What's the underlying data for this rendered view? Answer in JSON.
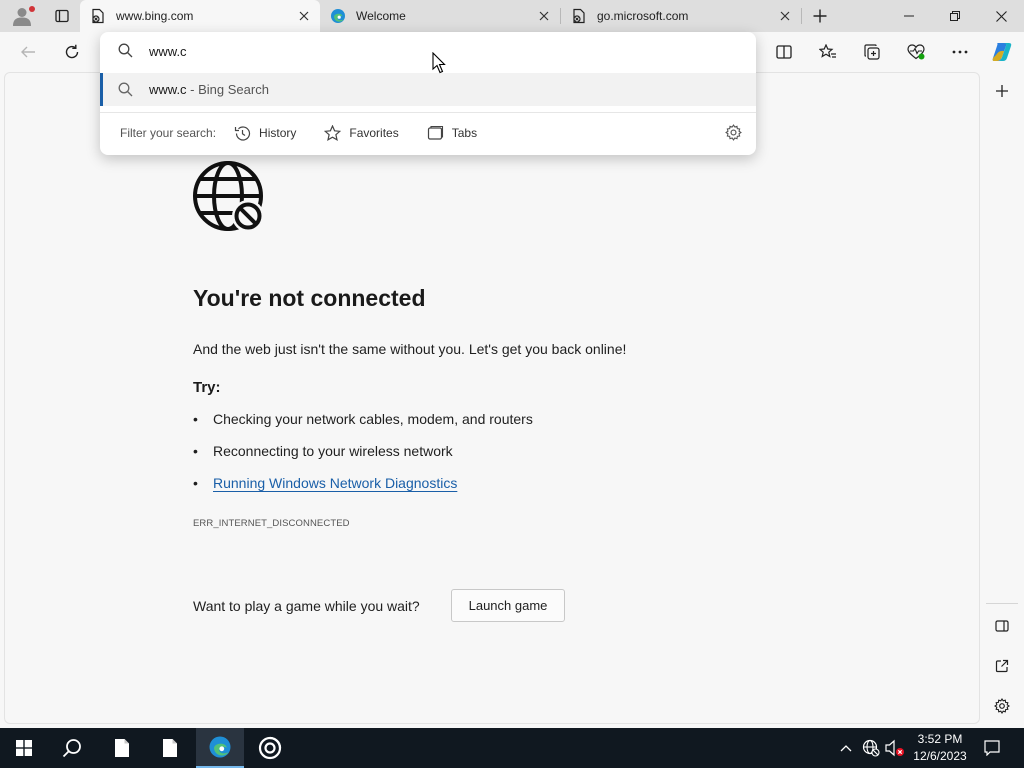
{
  "tabs": [
    {
      "title": "www.bing.com",
      "active": true,
      "icon": "page-broken-icon"
    },
    {
      "title": "Welcome",
      "active": false,
      "icon": "edge-logo-icon"
    },
    {
      "title": "go.microsoft.com",
      "active": false,
      "icon": "page-broken-icon"
    }
  ],
  "address_bar": {
    "typed_text": "www.c",
    "suggestion_query": "www.c",
    "suggestion_suffix": " - Bing Search",
    "filter_label": "Filter your search:",
    "filters": [
      "History",
      "Favorites",
      "Tabs"
    ]
  },
  "error_page": {
    "title": "You're not connected",
    "subtitle": "And the web just isn't the same without you. Let's get you back online!",
    "try_label": "Try:",
    "suggestions": [
      "Checking your network cables, modem, and routers",
      "Reconnecting to your wireless network",
      "Running Windows Network Diagnostics"
    ],
    "error_code": "ERR_INTERNET_DISCONNECTED",
    "game_prompt": "Want to play a game while you wait?",
    "game_button": "Launch game"
  },
  "taskbar": {
    "time": "3:52 PM",
    "date": "12/6/2023"
  },
  "colors": {
    "accent": "#1a5fa8",
    "page_bg": "#f7f7f7",
    "tabstrip_bg": "#dedede",
    "taskbar_bg": "#101820"
  }
}
